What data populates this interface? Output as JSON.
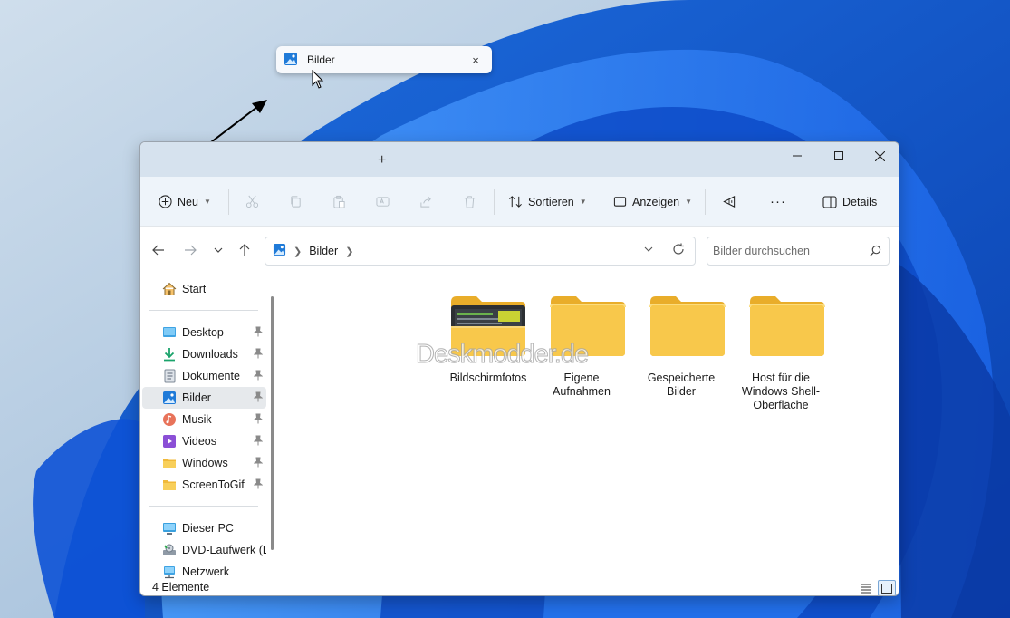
{
  "drag_tab": {
    "title": "Bilder",
    "close_icon": "×"
  },
  "window": {
    "titlebar": {
      "new_tab": "+"
    },
    "toolbar": {
      "new_label": "Neu",
      "sort_label": "Sortieren",
      "view_label": "Anzeigen",
      "more_label": "···",
      "details_label": "Details"
    },
    "address": {
      "location": "Bilder",
      "search_placeholder": "Bilder durchsuchen"
    },
    "sidebar": {
      "items": [
        {
          "label": "Start",
          "icon": "home-icon"
        },
        {
          "label": "Desktop",
          "icon": "desktop-icon",
          "pinned": true
        },
        {
          "label": "Downloads",
          "icon": "download-icon",
          "pinned": true
        },
        {
          "label": "Dokumente",
          "icon": "document-icon",
          "pinned": true
        },
        {
          "label": "Bilder",
          "icon": "pictures-icon",
          "pinned": true,
          "selected": true
        },
        {
          "label": "Musik",
          "icon": "music-icon",
          "pinned": true
        },
        {
          "label": "Videos",
          "icon": "video-icon",
          "pinned": true
        },
        {
          "label": "Windows",
          "icon": "folder-icon",
          "pinned": true
        },
        {
          "label": "ScreenToGif",
          "icon": "folder-icon",
          "pinned": true
        },
        {
          "label": "Dieser PC",
          "icon": "pc-icon"
        },
        {
          "label": "DVD-Laufwerk (D:",
          "icon": "dvd-icon"
        },
        {
          "label": "Netzwerk",
          "icon": "network-icon"
        }
      ]
    },
    "folders": [
      {
        "label": "Bildschirmfotos",
        "thumbnail": true
      },
      {
        "label": "Eigene Aufnahmen"
      },
      {
        "label": "Gespeicherte Bilder"
      },
      {
        "label": "Host für die Windows Shell-Oberfläche"
      }
    ],
    "watermark": "Deskmodder.de",
    "status": {
      "count": "4 Elemente"
    }
  },
  "colors": {
    "accent": "#0067c0",
    "folder": "#f8c84b",
    "titlebar": "#d6e2ee"
  }
}
